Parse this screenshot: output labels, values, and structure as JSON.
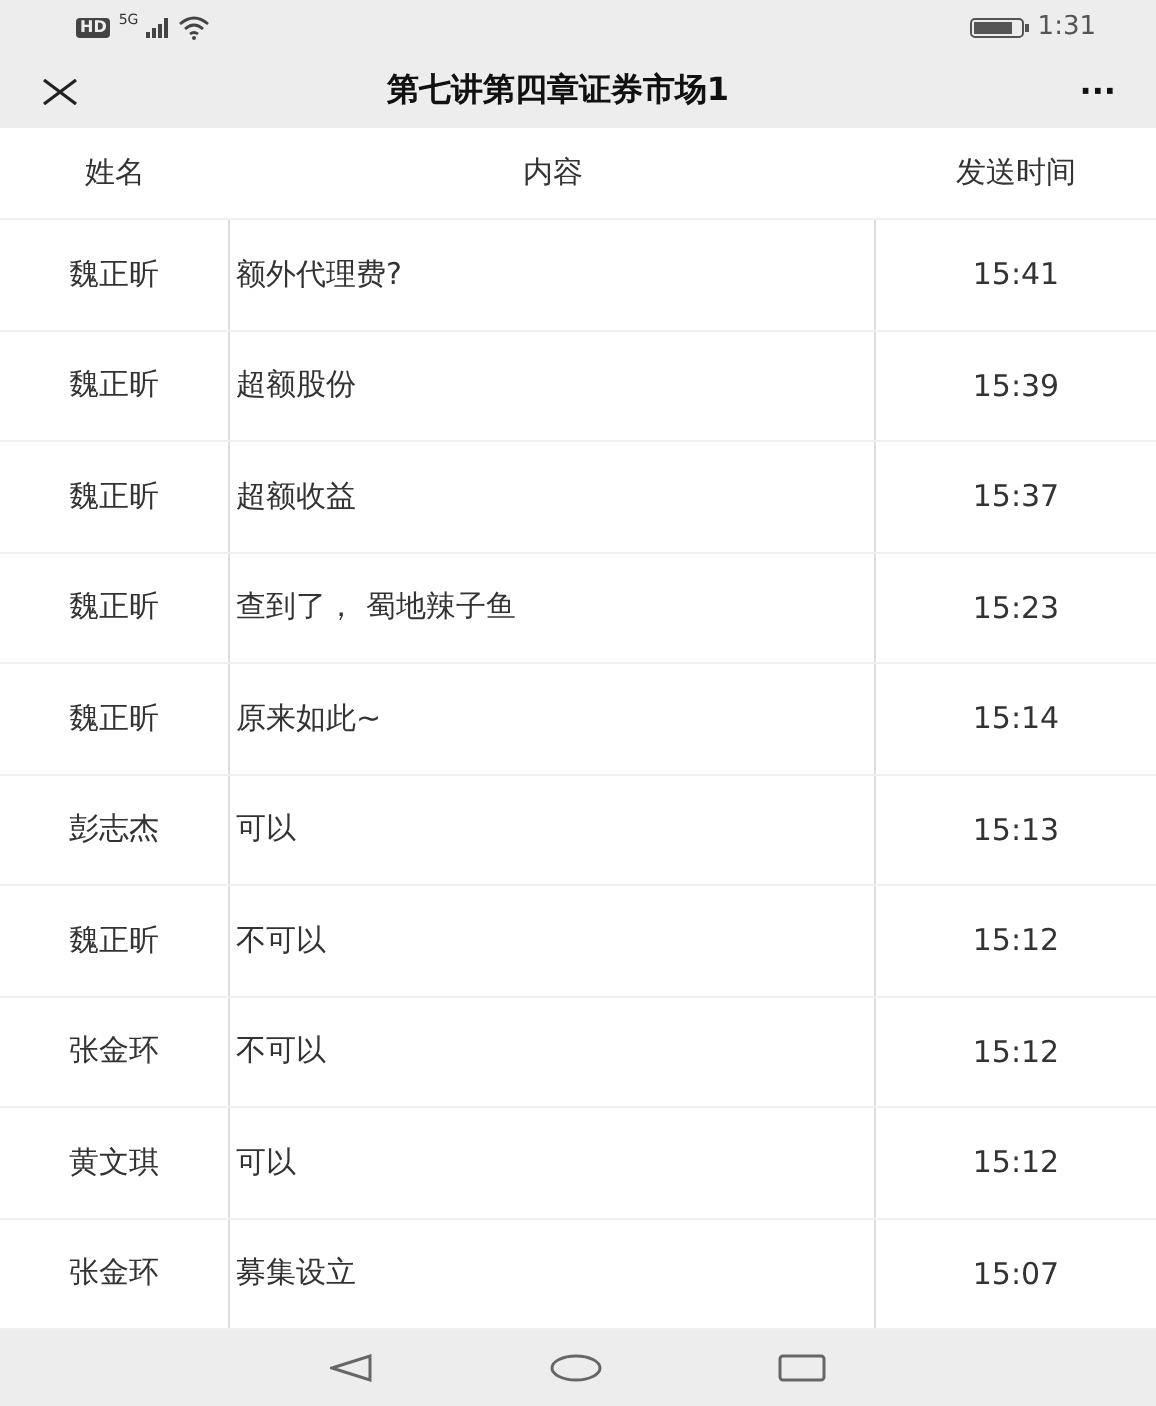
{
  "status_bar": {
    "hd": "HD",
    "network": "5G",
    "time": "1:31"
  },
  "title_bar": {
    "title": "第七讲第四章证券市场1",
    "more": "···"
  },
  "table": {
    "columns": [
      "姓名",
      "内容",
      "发送时间"
    ],
    "rows": [
      {
        "name": "魏正昕",
        "content": "额外代理费?",
        "time": "15:41"
      },
      {
        "name": "魏正昕",
        "content": "超额股份",
        "time": "15:39"
      },
      {
        "name": "魏正昕",
        "content": "超额收益",
        "time": "15:37"
      },
      {
        "name": "魏正昕",
        "content": "查到了， 蜀地辣子鱼",
        "time": "15:23"
      },
      {
        "name": "魏正昕",
        "content": "原来如此~",
        "time": "15:14"
      },
      {
        "name": "彭志杰",
        "content": "可以",
        "time": "15:13"
      },
      {
        "name": "魏正昕",
        "content": "不可以",
        "time": "15:12"
      },
      {
        "name": "张金环",
        "content": "不可以",
        "time": "15:12"
      },
      {
        "name": "黄文琪",
        "content": "可以",
        "time": "15:12"
      },
      {
        "name": "张金环",
        "content": "募集设立",
        "time": "15:07"
      }
    ]
  }
}
